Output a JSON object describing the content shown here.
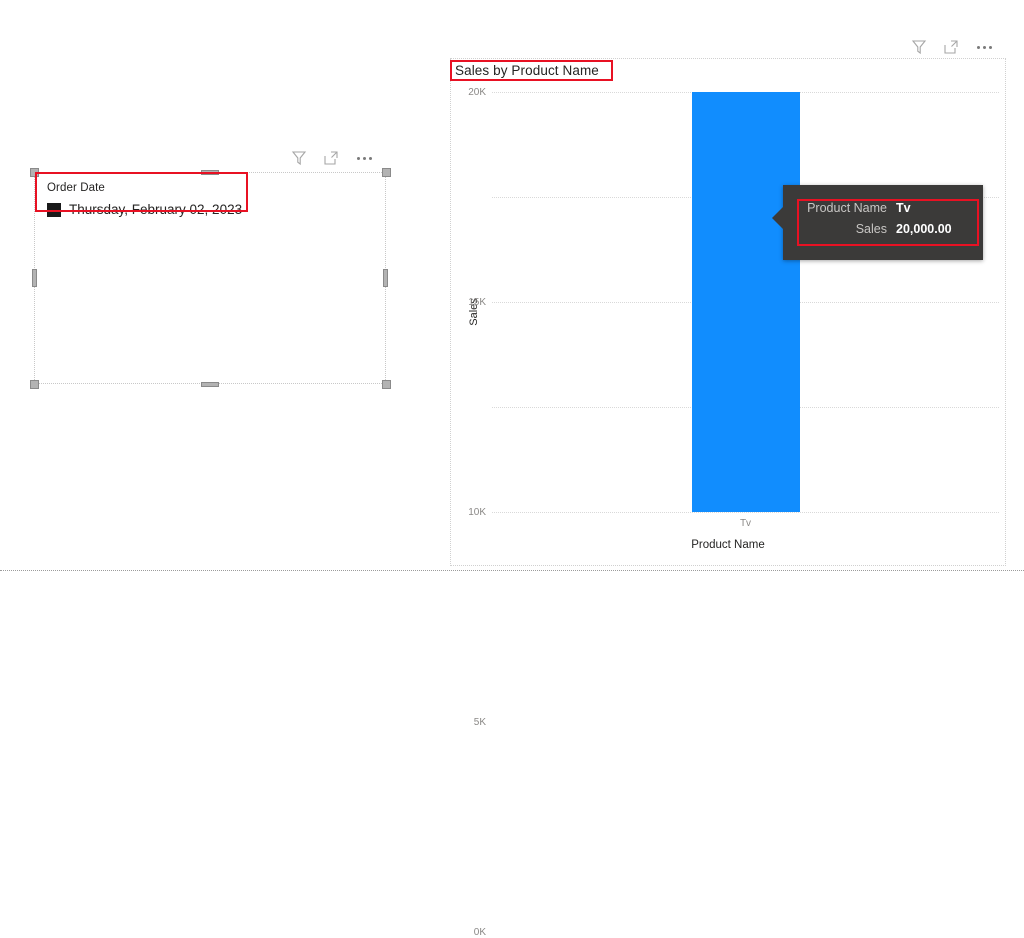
{
  "slicer": {
    "field_title": "Order Date",
    "selected_value": "Thursday, February 02, 2023",
    "swatch_color": "#1a1a1a",
    "icons": {
      "filter": "filter-icon",
      "focus": "focus-mode-icon",
      "more": "more-options-icon"
    }
  },
  "chart": {
    "title": "Sales by Product Name",
    "icons": {
      "filter": "filter-icon",
      "focus": "focus-mode-icon",
      "more": "more-options-icon"
    },
    "bar_color": "#118DFE"
  },
  "tooltip": {
    "rows": [
      {
        "label": "Product Name",
        "value": "Tv"
      },
      {
        "label": "Sales",
        "value": "20,000.00"
      }
    ],
    "background_color": "#3b3a39"
  },
  "highlight_color": "#e81123",
  "chart_data": {
    "type": "bar",
    "title": "Sales by Product Name",
    "xlabel": "Product Name",
    "ylabel": "Sales",
    "categories": [
      "Tv"
    ],
    "values": [
      20000
    ],
    "ylim": [
      0,
      20000
    ],
    "yticks": [
      0,
      5000,
      10000,
      15000,
      20000
    ],
    "ytick_labels": [
      "0K",
      "5K",
      "10K",
      "15K",
      "20K"
    ],
    "grid": true,
    "legend": "none",
    "series": [
      {
        "name": "Sales",
        "values": [
          20000
        ],
        "color": "#118DFE"
      }
    ]
  }
}
